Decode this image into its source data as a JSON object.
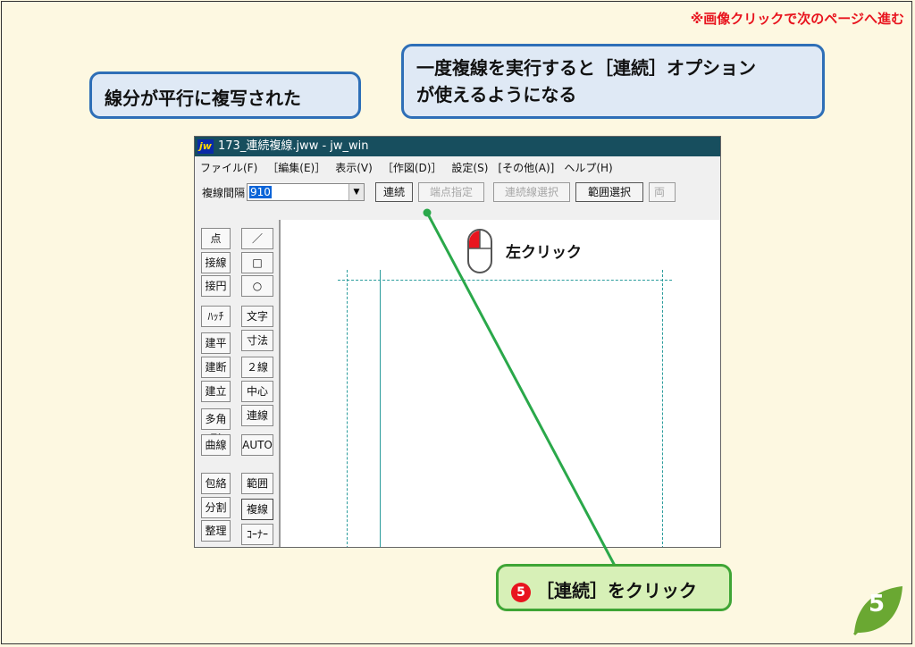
{
  "header_note": "※画像クリックで次のページへ進む",
  "callouts": {
    "left": "線分が平行に複写された",
    "right_line1": "一度複線を実行すると［連続］オプション",
    "right_line2": "が使えるようになる"
  },
  "window": {
    "icon_text": "jw",
    "title": "173_連続複線.jww - jw_win",
    "menu": [
      "ファイル(F)",
      "［編集(E)］",
      "表示(V)",
      "［作図(D)］",
      "設定(S)",
      "[その他(A)]",
      "ヘルプ(H)"
    ],
    "toolbar": {
      "label": "複線間隔",
      "value": "910",
      "buttons": [
        "連続",
        "端点指定",
        "連続線選択",
        "範囲選択",
        "両"
      ]
    },
    "tools_left": [
      "点",
      "接線",
      "接円",
      "ﾊｯﾁ",
      "建平",
      "建断",
      "建立",
      "多角形",
      "曲線",
      "包絡",
      "分割",
      "整理"
    ],
    "tools_right": [
      "／",
      "□",
      "○",
      "文字",
      "寸法",
      "２線",
      "中心線",
      "連線",
      "AUTO",
      "範囲",
      "複線",
      "ｺｰﾅｰ"
    ]
  },
  "annotation": {
    "click_label": "左クリック",
    "step_number": "5",
    "step_text": "［連続］をクリック"
  },
  "page_number": "5",
  "colors": {
    "background": "#fdf8e1",
    "titlebar": "#174e5e",
    "callout_border": "#2e6fb7",
    "step_border": "#3fa535",
    "accent_red": "#e8141e",
    "leaf_green": "#6aa832"
  }
}
